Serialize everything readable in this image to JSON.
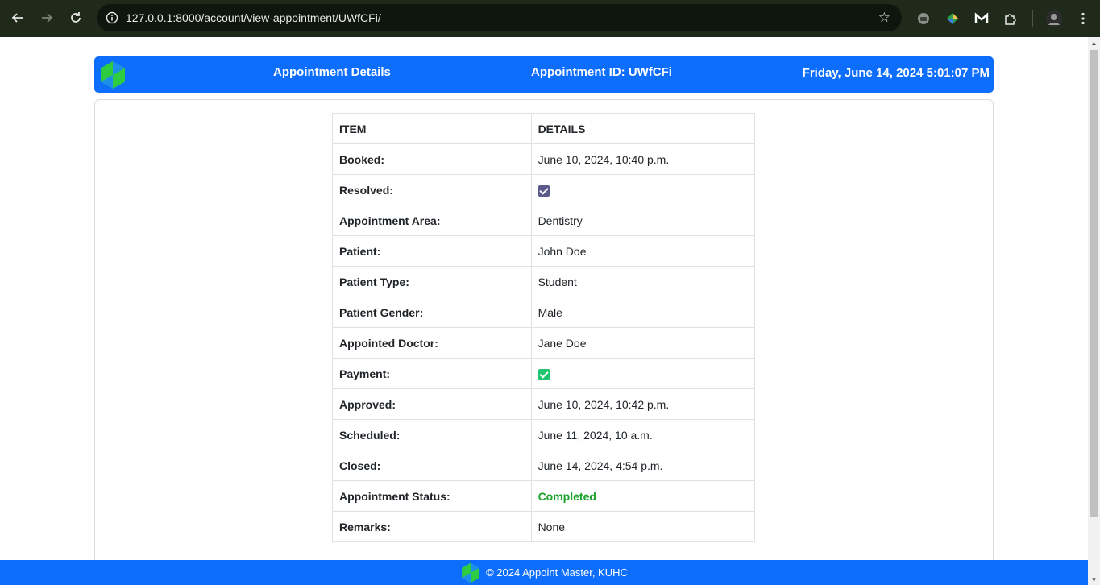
{
  "browser": {
    "url": "127.0.0.1:8000/account/view-appointment/UWfCFi/"
  },
  "header": {
    "logo_text": "Appoint Master",
    "title": "Appointment Details",
    "appointment_id": "Appointment ID: UWfCFi",
    "datetime": "Friday, June 14, 2024 5:01:07 PM"
  },
  "table": {
    "headers": [
      "ITEM",
      "DETAILS"
    ],
    "rows": [
      {
        "label": "Booked:",
        "value": "June 10, 2024, 10:40 p.m."
      },
      {
        "label": "Resolved:",
        "checked": true,
        "check_color": "#5b5a8a"
      },
      {
        "label": "Appointment Area:",
        "value": "Dentistry"
      },
      {
        "label": "Patient:",
        "value": "John Doe"
      },
      {
        "label": "Patient Type:",
        "value": "Student"
      },
      {
        "label": "Patient Gender:",
        "value": "Male"
      },
      {
        "label": "Appointed Doctor:",
        "value": "Jane Doe"
      },
      {
        "label": "Payment:",
        "checked": true,
        "check_color": "#1fc46e"
      },
      {
        "label": "Approved:",
        "value": "June 10, 2024, 10:42 p.m."
      },
      {
        "label": "Scheduled:",
        "value": "June 11, 2024, 10 a.m."
      },
      {
        "label": "Closed:",
        "value": "June 14, 2024, 4:54 p.m."
      },
      {
        "label": "Appointment Status:",
        "value": "Completed"
      },
      {
        "label": "Remarks:",
        "value": "None"
      }
    ]
  },
  "footer": {
    "text": "© 2024 Appoint Master, KUHC"
  },
  "colors": {
    "primary": "#0d6efd",
    "status_completed": "#1aa32a"
  }
}
